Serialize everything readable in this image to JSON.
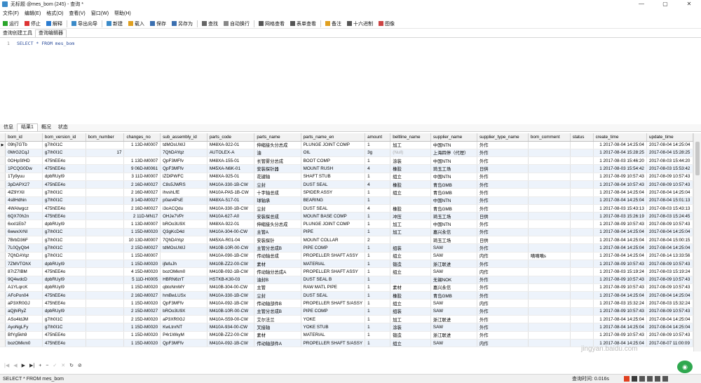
{
  "window": {
    "title": "无标题 @mes_bom (245) - 查询 *",
    "controls": [
      "—",
      "▢",
      "✕"
    ]
  },
  "menu": [
    "文件(F)",
    "编辑(E)",
    "格式(O)",
    "查看(V)",
    "窗口(W)",
    "帮助(H)"
  ],
  "toolbar": [
    {
      "label": "运行",
      "icon": "run-icon",
      "color": "#2aa52a"
    },
    {
      "label": "停止",
      "icon": "stop-icon",
      "color": "#d33"
    },
    {
      "label": "解释",
      "icon": "explain-icon",
      "color": "#2a7bd0"
    },
    {
      "label": "导出向导",
      "icon": "export-icon",
      "color": "#3a8ac8"
    },
    {
      "label": "新建",
      "icon": "new-icon",
      "color": "#3a8ac8"
    },
    {
      "label": "载入",
      "icon": "folder-icon",
      "color": "#e0a020"
    },
    {
      "label": "保存",
      "icon": "save-icon",
      "color": "#3a6fb0"
    },
    {
      "label": "另存为",
      "icon": "save-as-icon",
      "color": "#3a6fb0"
    },
    {
      "label": "查找",
      "icon": "search-icon",
      "color": "#666"
    },
    {
      "label": "自动换行",
      "icon": "wrap-icon",
      "color": "#888"
    },
    {
      "label": "网格查看",
      "icon": "grid-icon",
      "color": "#555"
    },
    {
      "label": "表单查看",
      "icon": "form-icon",
      "color": "#555"
    },
    {
      "label": "备注",
      "icon": "note-icon",
      "color": "#e0a020"
    },
    {
      "label": "十六进制",
      "icon": "hex-icon",
      "color": "#555"
    },
    {
      "label": "图像",
      "icon": "image-icon",
      "color": "#c44"
    }
  ],
  "subtabs": [
    "查询创建工具",
    "查询编辑器"
  ],
  "editor": {
    "line": "1",
    "sql": "SELECT * FROM mes_bom"
  },
  "result_tabs": [
    "信息",
    "结果1",
    "概况",
    "状态"
  ],
  "grid": {
    "columns": [
      "bom_id",
      "bom_version_id",
      "bom_number",
      "changes_no",
      "sub_assembly_id",
      "parts_code",
      "parts_name",
      "parts_name_en",
      "amount",
      "beltline_name",
      "supplier_name",
      "supplier_type_name",
      "bom_comment",
      "status",
      "create_time",
      "update_time"
    ],
    "rows": [
      [
        "09hj7GTb",
        "g7Ih0I1C",
        "",
        "1 13D-M0007",
        "tdMOsUWJ",
        "M48XA-922-01",
        "伸缩接头分总成",
        "PLUNGE JOINT COMP",
        "1",
        "加工",
        "中国NTN",
        "外作",
        "",
        "",
        "1 2017-08-04 14:25:04",
        "2017-08-04 14:25:04"
      ],
      [
        "0MrG2CqJ",
        "g7Ih0I1C",
        "17",
        "",
        "7QhDAYqz",
        "AUTOLEX-A",
        "油",
        "OIL",
        "3g",
        "(Null)",
        "上海四停（代理）",
        "外作",
        "",
        "",
        "1 2017-08-04 15:28:25",
        "2017-08-04 15:28:25"
      ],
      [
        "0OHpSfHD",
        "475hEE4o",
        "",
        "1 13D-M0007",
        "QpF3MFfv",
        "M48XA-155-01",
        "长管雾分总成",
        "BOOT COMP",
        "1",
        "涂装",
        "中国NTN",
        "外作",
        "",
        "",
        "1 2017-08-03 15:46:20",
        "2017-08-03 15:44:20"
      ],
      [
        "1PCQG0Dw",
        "475hEE4o",
        "",
        "9 06D-M0061",
        "QpF3MFfv",
        "M45XA-N6K-01",
        "安装探针器",
        "MOUNT RUSH",
        "4",
        "橡胶",
        "琦玉工场",
        "日供",
        "",
        "",
        "1 2017-08-03 15:54:42",
        "2017-08-03 15:53:42"
      ],
      [
        "1Ty9yuu",
        "dpbRUyI9",
        "",
        "3 11D-M0007",
        "lZDlPWFC",
        "M48XA-925-01",
        "花键轴",
        "SHAFT STUB",
        "1",
        "组立",
        "中国NTN",
        "外作",
        "",
        "",
        "1 2017-08-09 10:57:43",
        "2017-08-09 10:57:43"
      ],
      [
        "3pDAPX27",
        "475hEE4o",
        "",
        "2 16D-M0027",
        "C8s5JWRS",
        "M410A-330-1B-CW",
        "尘封",
        "DUST SEAL",
        "4",
        "橡胶",
        "青岛GMB",
        "外作",
        "",
        "",
        "1 2017-08-04 10:57:43",
        "2017-08-09 10:57:43"
      ],
      [
        "4lZ9YXiI",
        "g7Ih0I1C",
        "",
        "2 16D-M0027",
        "ihvshLfE",
        "M410A-PA5-1B-CW",
        "十字轴总成",
        "SPIDER ASSY",
        "1",
        "组立",
        "青岛GMB",
        "外作",
        "",
        "",
        "1 2017-08-04 14:25:04",
        "2017-08-04 14:25:04"
      ],
      [
        "4s8Hdhin",
        "g7Ih0I1C",
        "",
        "3 14D-M0027",
        "p0an4PsE",
        "M48XA-517-01",
        "球轴承",
        "BEARING",
        "1",
        "",
        "中国NTN",
        "外作",
        "",
        "",
        "1 2017-08-04 14:25:04",
        "2017-08-04 15:01:13"
      ],
      [
        "4WAIwgcz",
        "475hEE4o",
        "",
        "2 16D-M0027",
        "i3oACQdu",
        "M410A-330-1B-CW",
        "尘封",
        "DUST SEAL",
        "4",
        "橡胶",
        "青岛GMB",
        "外作",
        "",
        "",
        "1 2017-08-03 15:43:13",
        "2017-08-03 15:43:13"
      ],
      [
        "6QX70h2n",
        "475hEE4o",
        "",
        "2 11D-MN17",
        "OHJe7VPr",
        "M410A-627-A0",
        "安装探总成",
        "MOUNT BASE COMP",
        "1",
        "冲压",
        "琦玉工场",
        "日供",
        "",
        "",
        "1 2017-08-03 15:26:19",
        "2017-08-03 15:24:45"
      ],
      [
        "6xxI1Eb7",
        "dpbRUyI9",
        "",
        "1 13D-M0007",
        "bROo3U9X",
        "M48XA-922-01",
        "伸缩接头分总成",
        "PLUNGE JOINT COMP",
        "1",
        "加工",
        "中国NTN",
        "外作",
        "",
        "",
        "1 2017-08-09 10:57:43",
        "2017-08-09 10:57:43"
      ],
      [
        "6wwxXrNI",
        "g7Ih0I1C",
        "",
        "1 15D-M0020",
        "Q3gKcD4d",
        "M410A-304-00-CW",
        "主管A",
        "PIPE",
        "1",
        "加工",
        "嘉兴永信",
        "外作",
        "",
        "",
        "1 2017-08-04 14:25:04",
        "2017-08-04 14:25:04"
      ],
      [
        "7BrbD36F",
        "g7Ih0I1C",
        "",
        "10 13D-M0007",
        "7QhDAYqz",
        "M45XA-R01-04",
        "安装探针",
        "MOUNT COLLAR",
        "2",
        "",
        "琦玉工场",
        "日供",
        "",
        "",
        "1 2017-08-04 14:25:04",
        "2017-08-04 15:00:15"
      ],
      [
        "7L0QyQb4",
        "g7Ih0I1C",
        "",
        "2 15D-M0027",
        "tdMOsUWJ",
        "M410B-10R-00-CW",
        "主管分总成B",
        "PIPE COMP",
        "1",
        "组装",
        "SAW",
        "外作",
        "",
        "",
        "1 2017-08-04 14:25:04",
        "2017-08-04 14:25:04"
      ],
      [
        "7QhDAYqz",
        "g7Ih0I1C",
        "",
        "1 15D-M0007",
        "",
        "M410A-090-1B-CW",
        "传动轴总成",
        "PROPELLER SHAFT ASSY",
        "1",
        "组立",
        "SAW",
        "内作",
        "嘀嘀嘀s",
        "",
        "1 2017-08-04 14:25:04",
        "2017-08-14 13:33:56"
      ],
      [
        "7ZMVTOhX",
        "dpbRUyI9",
        "",
        "1 15D-M0020",
        "ijfefuJh",
        "M410B-ZZ2-00-CW",
        "素材",
        "MATERIAL",
        "1",
        "锻造",
        "浙江联进",
        "外作",
        "",
        "",
        "1 2017-08-09 10:57:43",
        "2017-08-09 10:57:43"
      ],
      [
        "87rZ7IBM",
        "475hEE4o",
        "",
        "4 15D-M0020",
        "bozOMkm0",
        "M410B-092-1B-CW",
        "传动轴分总成A",
        "PROPELLER SHAFT ASSY",
        "1",
        "组立",
        "SAW",
        "内作",
        "",
        "",
        "1 2017-08-03 15:19:24",
        "2017-08-03 15:19:24"
      ],
      [
        "9Q4wdcD",
        "dpbRUyI9",
        "",
        "5 11D-H0005",
        "HBRN6zrT",
        "HSTKB-K30-03",
        "油封B",
        "DUST SEAL B",
        "1",
        "",
        "无锡NOK",
        "外作",
        "",
        "",
        "1 2017-08-09 10:57:43",
        "2017-08-09 10:57:43"
      ],
      [
        "A1YLqrcK",
        "dpbRUyI9",
        "",
        "1 15D-M0020",
        "qbtoNmMY",
        "M410B-304-00-CW",
        "主管",
        "RAW MATL PIPE",
        "1",
        "素材",
        "嘉兴永信",
        "外作",
        "",
        "",
        "1 2017-08-09 10:57:43",
        "2017-08-09 10:57:43"
      ],
      [
        "AFoPon04",
        "475hEE4o",
        "",
        "2 16D-M0027",
        "hmBwLUSx",
        "M410A-330-1B-CW",
        "尘封",
        "DUST SEAL",
        "1",
        "橡胶",
        "青岛GMB",
        "外作",
        "",
        "",
        "1 2017-08-04 14:25:04",
        "2017-08-04 14:25:04"
      ],
      [
        "aP3XR0GJ",
        "475hEE4o",
        "",
        "1 15D-M0020",
        "QpF3MFfv",
        "M410A-092-1B-CW",
        "传动轴部件B",
        "PROPELLER SHAFT S/ASSY",
        "1",
        "组立",
        "SAW",
        "内作",
        "",
        "",
        "1 2017-08-03 15:32:24",
        "2017-08-03 15:32:24"
      ],
      [
        "aQjhiRyZ",
        "dpbRUyI9",
        "",
        "2 15D-M0027",
        "bROo3U9X",
        "M410B-10R-00-CW",
        "主管分总成B",
        "PIPE COMP",
        "1",
        "组装",
        "SAW",
        "外作",
        "",
        "",
        "1 2017-08-09 10:57:43",
        "2017-08-09 10:57:43"
      ],
      [
        "ASo4IdJM",
        "g7Ih0I1C",
        "",
        "2 15D-M0020",
        "aP3XR0GJ",
        "M410A-S59-00-CW",
        "艾尔法兰",
        "YOKE",
        "1",
        "加工",
        "浙江联进",
        "外作",
        "",
        "",
        "1 2017-08-04 14:25:04",
        "2017-08-04 14:25:04"
      ],
      [
        "AyoNgLFy",
        "g7Ih0I1C",
        "",
        "1 15D-M0020",
        "KwLtnrNT",
        "M410A-934-00-CW",
        "叉接轴",
        "YOKE STUB",
        "1",
        "涂装",
        "SAW",
        "外作",
        "",
        "",
        "1 2017-08-04 14:25:04",
        "2017-08-04 14:25:04"
      ],
      [
        "BfYg5kh9",
        "475hEE4o",
        "",
        "1 15D-M0020",
        "P4r1WkyM",
        "M410B-ZZ2-00-CW",
        "素材",
        "MATERIAL",
        "1",
        "锻造",
        "浙江联进",
        "外作",
        "",
        "",
        "1 2017-08-09 10:57:43",
        "2017-08-09 10:57:43"
      ],
      [
        "bozOMkm0",
        "475hEE4o",
        "",
        "1 15D-M0020",
        "QpF3MFfv",
        "M410A-092-1B-CW",
        "传动轴部件A",
        "PROPELLER SHAFT S/ASSY",
        "1",
        "组立",
        "SAW",
        "内作",
        "",
        "",
        "1 2017-08-04 14:25:04",
        "2017-08-07 11:00:09"
      ]
    ]
  },
  "navigation": [
    "|◀",
    "◀",
    "▶",
    "▶|",
    "+",
    "−",
    "✓",
    "✕",
    "↻",
    "⊘"
  ],
  "status": {
    "sql": "SELECT * FROM mes_bom",
    "timing": "查询时间: 0.016s"
  },
  "watermark": {
    "text": "jingyan.baidu.com",
    "color": "#2fa84f"
  }
}
